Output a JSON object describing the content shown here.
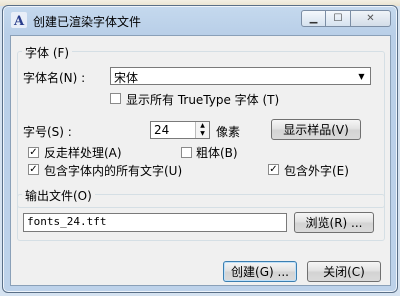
{
  "window": {
    "title": "创建已渲染字体文件",
    "icon": "font-app-icon",
    "minimize": "▁",
    "maximize": "☐",
    "close": "✕"
  },
  "font_group": {
    "legend": "字体 (F)",
    "font_name_label": "字体名(N)  :",
    "font_name_value": "宋体",
    "show_truetype_label": "显示所有 TrueType 字体 (T)",
    "show_truetype_checked": false,
    "size_label": "字号(S)  :",
    "size_value": "24",
    "size_unit": "像素",
    "show_sample_button": "显示样品(V)",
    "antialias_label": "反走样处理(A)",
    "antialias_checked": true,
    "bold_label": "粗体(B)",
    "bold_checked": false,
    "include_all_label": "包含字体内的所有文字(U)",
    "include_all_checked": true,
    "include_external_label": "包含外字(E)",
    "include_external_checked": true
  },
  "output_group": {
    "legend": "输出文件(O)",
    "file_value": "fonts_24.tft",
    "browse_button": "浏览(R) ..."
  },
  "buttons": {
    "create": "创建(G) ...",
    "close": "关闭(C)"
  }
}
